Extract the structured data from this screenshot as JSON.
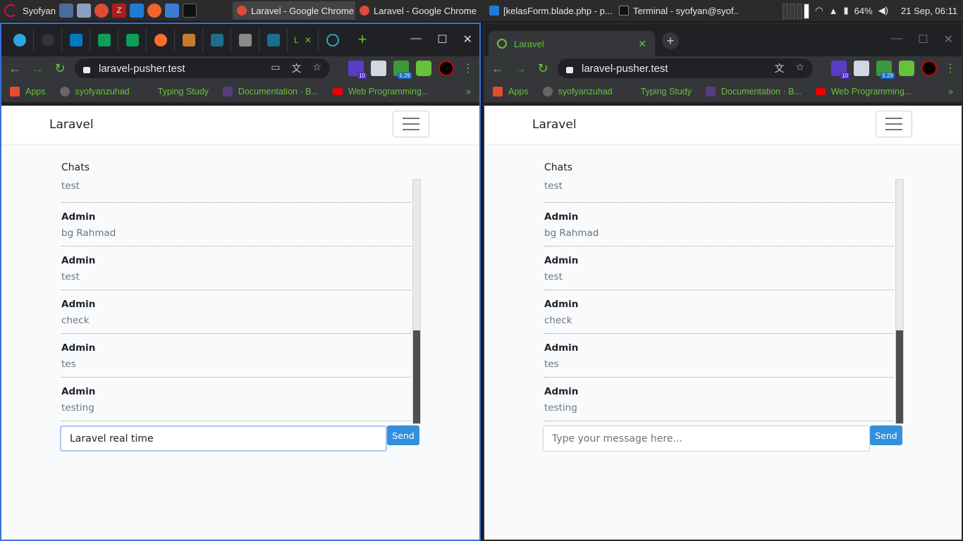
{
  "taskbar": {
    "user": "Syofyan",
    "tasks": [
      {
        "label": "Laravel - Google Chrome",
        "active": true
      },
      {
        "label": "Laravel - Google Chrome",
        "active": false
      },
      {
        "label": "[kelasForm.blade.php - p...",
        "active": false
      },
      {
        "label": "Terminal - syofyan@syof...",
        "active": false
      }
    ],
    "battery": "64%",
    "clock": "21 Sep, 06:11"
  },
  "left_window": {
    "url": "laravel-pusher.test",
    "tab_partial_label": "L",
    "ext_badge_1": "10",
    "ext_badge_2": "5:29"
  },
  "right_window": {
    "tab_title": "Laravel",
    "url": "laravel-pusher.test",
    "ext_badge_1": "10",
    "ext_badge_2": "5:29"
  },
  "bookmarks": {
    "items": [
      "Apps",
      "syofyanzuhad",
      "Typing Study",
      "Documentation · B...",
      "Web Programming..."
    ],
    "left_items": [
      "Apps",
      "syofyanzuhad",
      "Typing Study",
      "Documentation · B...",
      "Web Programming..."
    ],
    "more": "»"
  },
  "app": {
    "brand": "Laravel",
    "chats_title": "Chats",
    "first_message": "test",
    "messages": [
      {
        "user": "Admin",
        "text": "bg Rahmad"
      },
      {
        "user": "Admin",
        "text": "test"
      },
      {
        "user": "Admin",
        "text": "check"
      },
      {
        "user": "Admin",
        "text": "tes"
      },
      {
        "user": "Admin",
        "text": "testing"
      }
    ],
    "send_label": "Send",
    "left_input_value": "Laravel real time",
    "placeholder": "Type your message here..."
  },
  "colors": {
    "accent_green": "#66c23a",
    "send_blue": "#3490dc",
    "focus_border": "#3a6fd8"
  }
}
